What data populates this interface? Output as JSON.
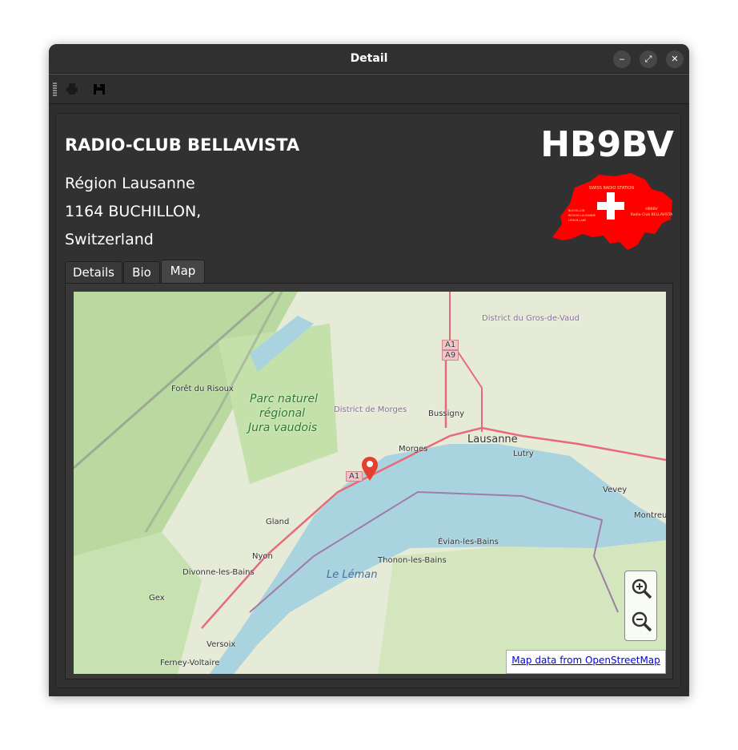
{
  "window": {
    "title": "Detail"
  },
  "toolbar": {
    "print": "print-icon",
    "save": "save-icon"
  },
  "station": {
    "name": "RADIO-CLUB BELLAVISTA",
    "callsign": "HB9BV",
    "address": [
      "Région Lausanne",
      "1164 BUCHILLON,",
      "Switzerland"
    ]
  },
  "logo": {
    "text": [
      "SWISS RADIO STATION",
      "BUCHILLON",
      "REGION LAUSANNE",
      "LEMAN LAKE",
      "HB9BV",
      "Radio-Club BELLAVISTA"
    ],
    "color": "#ff0000"
  },
  "tabs": [
    {
      "label": "Details"
    },
    {
      "label": "Bio"
    },
    {
      "label": "Map",
      "active": true
    }
  ],
  "map": {
    "labels": {
      "foret": "Forêt du Risoux",
      "parc1": "Parc naturel",
      "parc2": "régional",
      "parc3": "Jura vaudois",
      "morgesd": "District de Morges",
      "bussigny": "Bussigny",
      "lausanne": "Lausanne",
      "morges": "Morges",
      "lutry": "Lutry",
      "vevey": "Vevey",
      "montreux": "Montreux",
      "gland": "Gland",
      "nyon": "Nyon",
      "evian": "Évian-les-Bains",
      "thonon": "Thonon-les-Bains",
      "leman": "Le Léman",
      "divonne": "Divonne-les-Bains",
      "gex": "Gex",
      "versoix": "Versoix",
      "ferney": "Ferney-Voltaire",
      "gros": "District du Gros-de-Vaud",
      "a1": "A1",
      "a9": "A9"
    },
    "attribution": "Map data from OpenStreetMap",
    "zoom_in": "zoom-in-icon",
    "zoom_out": "zoom-out-icon",
    "marker": "map-pin-icon"
  }
}
